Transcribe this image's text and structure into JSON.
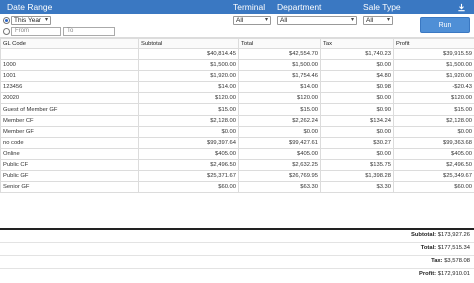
{
  "header": {
    "date_range": "Date Range",
    "terminal": "Terminal",
    "department": "Department",
    "sale_type": "Sale Type"
  },
  "filters": {
    "period": "This Year",
    "terminal": "All",
    "department": "All",
    "sale_type": "All",
    "from_placeholder": "From",
    "to_placeholder": "To",
    "run_label": "Run"
  },
  "table": {
    "columns": [
      "GL Code",
      "Subtotal",
      "Total",
      "Tax",
      "Profit"
    ],
    "rows": [
      [
        "",
        "$40,814.45",
        "$42,554.70",
        "$1,740.23",
        "$39,915.59"
      ],
      [
        "1000",
        "$1,500.00",
        "$1,500.00",
        "$0.00",
        "$1,500.00"
      ],
      [
        "1001",
        "$1,920.00",
        "$1,754.46",
        "$4.80",
        "$1,920.00"
      ],
      [
        "123456",
        "$14.00",
        "$14.00",
        "$0.98",
        "-$20.43"
      ],
      [
        "20020",
        "$120.00",
        "$120.00",
        "$0.00",
        "$120.00"
      ],
      [
        "Guest of Member GF",
        "$15.00",
        "$15.00",
        "$0.90",
        "$15.00"
      ],
      [
        "Member CF",
        "$2,128.00",
        "$2,262.24",
        "$134.24",
        "$2,128.00"
      ],
      [
        "Member GF",
        "$0.00",
        "$0.00",
        "$0.00",
        "$0.00"
      ],
      [
        "no code",
        "$99,397.64",
        "$99,427.61",
        "$30.27",
        "$99,363.68"
      ],
      [
        "Online",
        "$405.00",
        "$405.00",
        "$0.00",
        "$405.00"
      ],
      [
        "Public CF",
        "$2,496.50",
        "$2,632.25",
        "$135.75",
        "$2,496.50"
      ],
      [
        "Public GF",
        "$25,371.67",
        "$26,769.95",
        "$1,398.28",
        "$25,349.67"
      ],
      [
        "Senior GF",
        "$60.00",
        "$63.30",
        "$3.30",
        "$60.00"
      ]
    ]
  },
  "summary": {
    "subtotal_label": "Subtotal:",
    "subtotal_value": "$173,927.26",
    "total_label": "Total:",
    "total_value": "$177,515.34",
    "tax_label": "Tax:",
    "tax_value": "$3,578.08",
    "profit_label": "Profit:",
    "profit_value": "$172,910.01"
  },
  "colors": {
    "header_bg": "#3a78c2",
    "run_bg": "#4f8fd6"
  },
  "icons": {
    "download": "download-icon"
  }
}
